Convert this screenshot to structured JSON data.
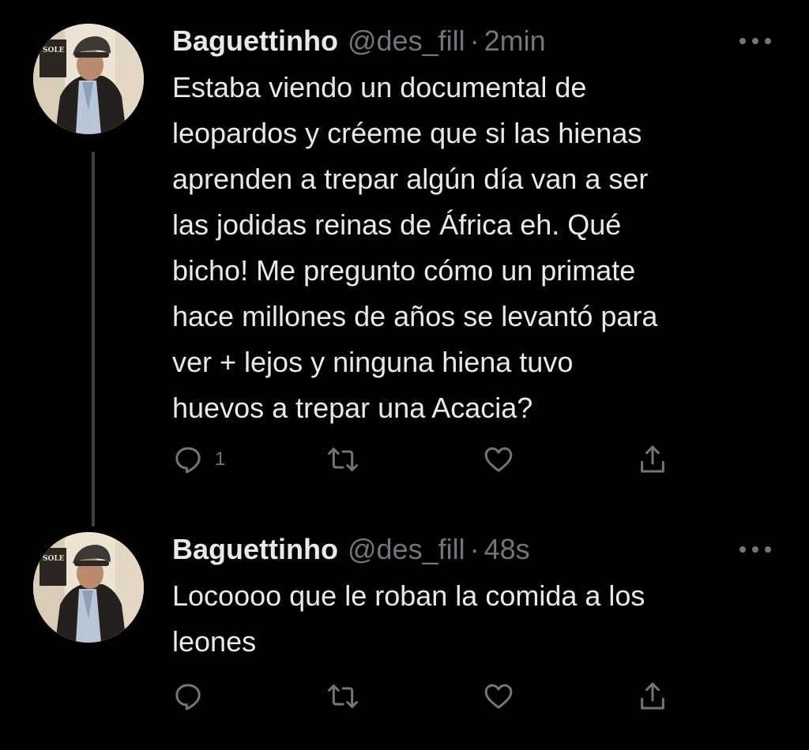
{
  "thread": [
    {
      "name": "Baguettinho",
      "handle": "@des_fill",
      "time": "2min",
      "text_lines": [
        "Estaba viendo un documental de",
        "leopardos y créeme que si las hienas",
        "aprenden a trepar algún día van a ser",
        "las jodidas reinas de África eh. Qué",
        "bicho! Me pregunto cómo un primate",
        "hace millones de años se levantó para",
        "ver + lejos y ninguna hiena tuvo",
        "huevos a trepar una Acacia?"
      ],
      "reply_count": "1",
      "avatar_text": "SOLE"
    },
    {
      "name": "Baguettinho",
      "handle": "@des_fill",
      "time": "48s",
      "text_lines": [
        "Locoooo que le roban la comida a los",
        "leones"
      ],
      "reply_count": "",
      "avatar_text": "SOLE"
    }
  ],
  "icons": {
    "reply": "reply-icon",
    "retweet": "retweet-icon",
    "like": "heart-icon",
    "share": "share-icon",
    "more": "more-icon"
  },
  "colors": {
    "background": "#000000",
    "primary_text": "#e7e9ea",
    "secondary_text": "#71767b",
    "thread_line": "#3e4144"
  }
}
